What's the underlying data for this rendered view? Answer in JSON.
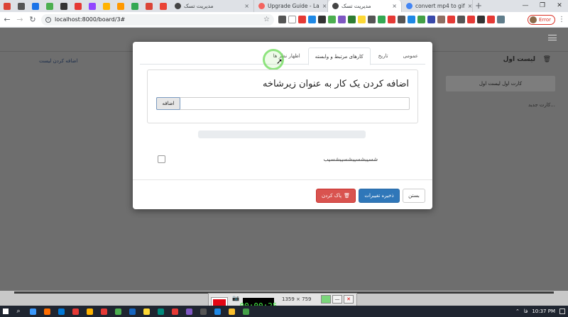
{
  "browser": {
    "pinned_favicon_colors": [
      "#db4437",
      "#555555",
      "#1a73e8",
      "#4caf50",
      "#333333",
      "#e53935",
      "#9146ff",
      "#ffb300",
      "#ff9800",
      "#34a853",
      "#db4437",
      "#ea4335"
    ],
    "tabs": [
      {
        "title": "مدیریت تسک",
        "favicon_color": "#444444",
        "active": false
      },
      {
        "title": "Upgrade Guide - La",
        "favicon_color": "#f4645f",
        "active": false
      },
      {
        "title": "مدیریت تسک",
        "favicon_color": "#444444",
        "active": true
      },
      {
        "title": "convert mp4 to gif",
        "favicon_color": "#4285f4",
        "active": false
      }
    ],
    "new_tab": "+",
    "url": "localhost:8000/board/3#",
    "profile_label": "Error",
    "extension_colors": [
      "#555555",
      "#ffffff",
      "#e53935",
      "#1e88e5",
      "#333333",
      "#4caf50",
      "#7e57c2",
      "#2e7d32",
      "#fdd835",
      "#555555",
      "#34a853",
      "#e53935",
      "#555555",
      "#1e88e5",
      "#43a047",
      "#3949ab",
      "#8d6e63",
      "#e53935",
      "#555555",
      "#e53935",
      "#333333",
      "#e53935",
      "#607d8b"
    ]
  },
  "board": {
    "list_title": "لیست اول",
    "card_title": "کارت اول لیست اول",
    "new_card": "کارت جدید...",
    "add_list": "اضافه کردن لیست"
  },
  "modal": {
    "tabs": [
      {
        "label": "عمومی",
        "active": false
      },
      {
        "label": "تاریخ",
        "active": false
      },
      {
        "label": "کارهای مرتبط و وابسته",
        "active": true
      },
      {
        "label": "نظرات و اظهار نظرها",
        "active": false
      }
    ],
    "tab_partial_label": "اظهار نظر ها",
    "panel_heading": "اضافه کردن یک کار به عنوان زیرشاخه",
    "subtask_input_value": "",
    "add_button": "اضافه",
    "progress": 0,
    "checklist_item_text": "شسیبشسیبشسیبشسیب",
    "checklist_checked": false,
    "buttons": {
      "close": "بستن",
      "save": "ذخیره تغییرات",
      "delete": "پاک کردن"
    }
  },
  "recorder": {
    "timer": "00:00:25",
    "size": "1359 × 759"
  },
  "taskbar": {
    "app_icon_colors": [
      "#3b99fc",
      "#ff6d00",
      "#0078d7",
      "#e53935",
      "#ffb300",
      "#e53935",
      "#4caf50",
      "#1565c0",
      "#fdd835",
      "#00897b",
      "#e53935",
      "#7e57c2",
      "#555555",
      "#1e88e5",
      "#fbc02d",
      "#43a047"
    ],
    "time": "10:37 PM",
    "language": "فا"
  }
}
